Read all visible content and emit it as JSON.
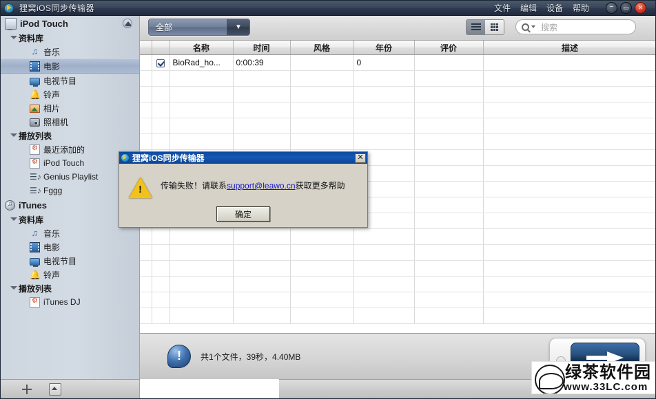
{
  "window": {
    "title": "狸窝iOS同步传输器",
    "app_icon": "globe-arrow-icon",
    "menus": [
      {
        "label": "文件",
        "name": "menu-file"
      },
      {
        "label": "编辑",
        "name": "menu-edit"
      },
      {
        "label": "设备",
        "name": "menu-device"
      },
      {
        "label": "帮助",
        "name": "menu-help"
      }
    ],
    "controls": {
      "minimize": "−",
      "maximize": "▭",
      "close": "✕"
    }
  },
  "sidebar": {
    "device": {
      "label": "iPod Touch",
      "icon": "computer-icon",
      "eject": "eject-icon"
    },
    "groups": [
      {
        "label": "资料库",
        "items": [
          {
            "label": "音乐",
            "icon": "music-note-icon"
          },
          {
            "label": "电影",
            "icon": "film-icon",
            "selected": true
          },
          {
            "label": "电视节目",
            "icon": "tv-icon"
          },
          {
            "label": "铃声",
            "icon": "bell-icon"
          },
          {
            "label": "相片",
            "icon": "photo-icon"
          },
          {
            "label": "照相机",
            "icon": "camera-icon"
          }
        ]
      },
      {
        "label": "播放列表",
        "items": [
          {
            "label": "最近添加的",
            "icon": "playlist-icon"
          },
          {
            "label": "iPod Touch",
            "icon": "playlist-icon"
          },
          {
            "label": "Genius Playlist",
            "icon": "genius-playlist-icon"
          },
          {
            "label": "Fggg",
            "icon": "genius-playlist-icon"
          }
        ]
      }
    ],
    "itunes": {
      "label": "iTunes",
      "icon": "itunes-icon",
      "groups": [
        {
          "label": "资料库",
          "items": [
            {
              "label": "音乐",
              "icon": "music-note-icon"
            },
            {
              "label": "电影",
              "icon": "film-icon"
            },
            {
              "label": "电视节目",
              "icon": "tv-icon"
            },
            {
              "label": "铃声",
              "icon": "bell-icon"
            }
          ]
        },
        {
          "label": "播放列表",
          "items": [
            {
              "label": "iTunes DJ",
              "icon": "playlist-icon"
            }
          ]
        }
      ]
    },
    "footer": {
      "add": "plus-icon",
      "eject": "eject-box-icon"
    }
  },
  "toolbar": {
    "filter_value": "全部",
    "filter_caret": "chevron-down-icon",
    "view_list": "list-view-icon",
    "view_grid": "grid-view-icon",
    "search_placeholder": "搜索",
    "search_value": ""
  },
  "table": {
    "columns": [
      "",
      "",
      "名称",
      "时间",
      "风格",
      "年份",
      "评价",
      "描述"
    ],
    "rows": [
      {
        "checked": true,
        "name": "BioRad_ho...",
        "time": "0:00:39",
        "genre": "",
        "year": "0",
        "rating": "",
        "description": ""
      }
    ],
    "empty_rows": 16
  },
  "bottom": {
    "status_icon": "info-bubble-icon",
    "status_text": "共1个文件，39秒，4.40MB",
    "transfer_button": "transfer-arrow-icon"
  },
  "dialog": {
    "title": "狸窝iOS同步传输器",
    "icon": "globe-arrow-icon",
    "close": "✕",
    "warning_icon": "warning-triangle-icon",
    "message_prefix": "传输失败！请联系",
    "message_link": "support@leawo.cn",
    "message_suffix": "获取更多帮助",
    "ok_button": "确定"
  },
  "watermark": {
    "name": "绿茶软件园",
    "url": "www.33LC.com"
  },
  "colors": {
    "titlebar": "#3b475a",
    "accent_blue": "#1558b4",
    "selection": "#9fb0c9",
    "link": "#1414c8",
    "close_red": "#d03a25"
  }
}
